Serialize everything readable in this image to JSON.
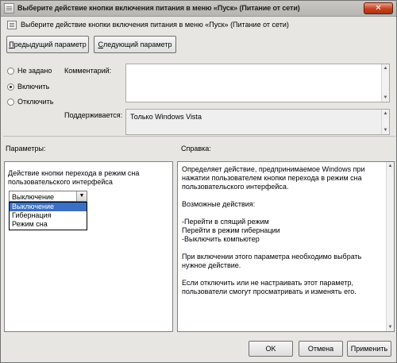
{
  "window": {
    "title": "Выберите действие кнопки включения питания в меню «Пуск» (Питание от сети)",
    "close_glyph": "✕"
  },
  "header": {
    "text": "Выберите действие кнопки включения питания в меню «Пуск» (Питание от сети)"
  },
  "nav": {
    "prev_label": "Предыдущий параметр",
    "prev_access": "П",
    "next_label": "Следующий параметр",
    "next_access": "С"
  },
  "state": {
    "options": [
      {
        "label": "Не задано",
        "checked": false
      },
      {
        "label": "Включить",
        "checked": true
      },
      {
        "label": "Отключить",
        "checked": false
      }
    ]
  },
  "comment": {
    "label": "Комментарий:",
    "value": ""
  },
  "supported": {
    "label": "Поддерживается:",
    "value": "Только Windows Vista"
  },
  "sections": {
    "options_label": "Параметры:",
    "help_label": "Справка:"
  },
  "options_panel": {
    "description": "Действие кнопки перехода в режим сна пользовательского интерфейса",
    "combo_value": "Выключение",
    "dropdown_items": [
      {
        "label": "Выключение",
        "selected": true
      },
      {
        "label": "Гибернация",
        "selected": false
      },
      {
        "label": "Режим сна",
        "selected": false
      }
    ]
  },
  "help_panel": {
    "paragraphs": [
      "Определяет действие, предпринимаемое Windows при нажатии пользователем кнопки перехода в режим сна пользовательского интерфейса.",
      "Возможные действия:",
      "-Перейти в спящий режим\nПерейти в режим гибернации\n-Выключить компьютер",
      "При включении этого параметра необходимо выбрать нужное действие.",
      "Если отключить или не настраивать этот параметр, пользователи смогут просматривать и изменять его."
    ]
  },
  "footer": {
    "ok_label": "OK",
    "cancel_label": "Отмена",
    "apply_label": "Применить"
  },
  "icons": {
    "scroll_up": "▲",
    "scroll_down": "▼",
    "combo_arrow": "▼"
  }
}
